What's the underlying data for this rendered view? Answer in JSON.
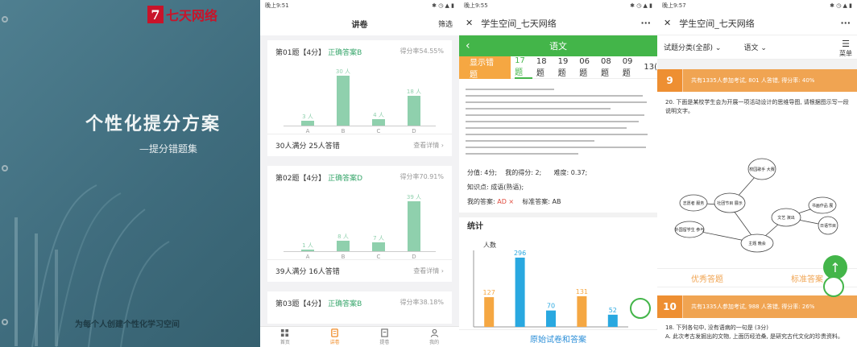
{
  "cover": {
    "logo_text": "七天网络",
    "logo_mark": "7",
    "title": "个性化提分方案",
    "subtitle": "—提分错题集",
    "footer": "为每个人创建个性化学习空间"
  },
  "screen2": {
    "status_time": "晚上9:51",
    "title": "讲卷",
    "filter": "筛选",
    "cards": [
      {
        "q": "第01题【4分】",
        "answer": "正确答案B",
        "rate": "得分率54.55%",
        "summary": "30人满分 25人答错",
        "detail": "查看详情",
        "bars": [
          {
            "label": "A",
            "value": 3,
            "text": "3 人"
          },
          {
            "label": "B",
            "value": 30,
            "text": "30 人"
          },
          {
            "label": "C",
            "value": 4,
            "text": "4 人"
          },
          {
            "label": "D",
            "value": 18,
            "text": "18 人"
          }
        ]
      },
      {
        "q": "第02题【4分】",
        "answer": "正确答案D",
        "rate": "得分率70.91%",
        "summary": "39人满分 16人答错",
        "detail": "查看详情",
        "bars": [
          {
            "label": "A",
            "value": 1,
            "text": "1 人"
          },
          {
            "label": "B",
            "value": 8,
            "text": "8 人"
          },
          {
            "label": "C",
            "value": 7,
            "text": "7 人"
          },
          {
            "label": "D",
            "value": 39,
            "text": "39 人"
          }
        ]
      },
      {
        "q": "第03题【4分】",
        "answer": "正确答案B",
        "rate": "得分率38.18%"
      }
    ],
    "tabs": [
      {
        "label": "首页",
        "icon": "grid-icon"
      },
      {
        "label": "讲卷",
        "icon": "paper-icon"
      },
      {
        "label": "提卷",
        "icon": "doc-icon"
      },
      {
        "label": "我的",
        "icon": "user-icon"
      }
    ]
  },
  "screen3": {
    "status_time": "晚上9:55",
    "wx_title": "学生空间_七天网络",
    "subject": "语文",
    "show_btn": "显示错题",
    "questions": [
      "17题",
      "18题",
      "19题",
      "06题",
      "08题",
      "09题",
      "13("
    ],
    "score": "分值: 4分;",
    "my_score": "我的得分: 2;",
    "difficulty": "难度: 0.37;",
    "knowledge": "知识点: 成语(熟语);",
    "my_answer_label": "我的答案:",
    "my_answer": "AD ×",
    "std_answer": "标准答案: AB",
    "stat_title": "统计",
    "footer": "原始试卷和答案"
  },
  "chart_data": {
    "type": "bar",
    "ylabel": "人数",
    "categories": [
      "A",
      "B",
      "C",
      "D",
      "E"
    ],
    "series": [
      {
        "values": [
          127,
          null,
          null,
          131,
          null
        ],
        "color": "#f5a742"
      },
      {
        "values": [
          null,
          296,
          70,
          null,
          52
        ],
        "color": "#29a8e0"
      }
    ],
    "ylim": [
      0,
      320
    ]
  },
  "screen4": {
    "status_time": "晚上9:57",
    "wx_title": "学生空间_七天网络",
    "filter_type": "试题分类(全部)",
    "filter_subject": "语文",
    "menu": "菜单",
    "sec9_num": "9",
    "sec9_text": "共有1335人参加考试, 801 人答错, 得分率: 40%",
    "q20_text": "20. 下面是某校学生会为开展一项活动设计的思维导图, 请根据图示写一段说明文字。",
    "map_nodes": [
      "主题 晚会",
      "校园歌手 大赛",
      "社团节目 展示",
      "文艺 演出",
      "志愿者 服务",
      "书画作品 展",
      "外国留学生 参与",
      "日语节目"
    ],
    "btn_good": "优秀答题",
    "btn_std": "标准答案",
    "sec10_num": "10",
    "sec10_text": "共有1335人参加考试, 988 人答错, 得分率: 26%",
    "q_next": "18. 下列各句中, 没有语病的一句是 (3分)",
    "q_next2": "A. 此次考古发掘出的文物, 上面历经沧桑, 是研究古代文化的珍贵资料。"
  },
  "colors": {
    "green": "#43b549",
    "orange": "#f5a742",
    "blue": "#29a8e0",
    "bar_green": "#8fd0ad"
  }
}
